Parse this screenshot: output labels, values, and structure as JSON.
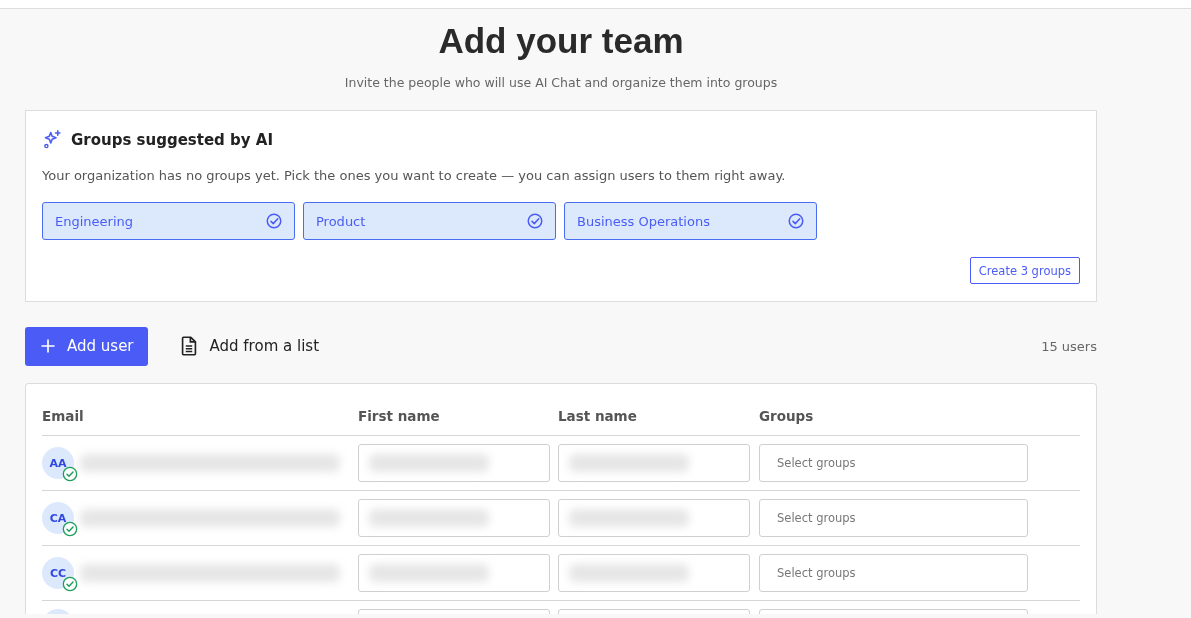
{
  "header": {
    "title": "Add your team",
    "subtitle": "Invite the people who will use AI Chat and organize them into groups"
  },
  "suggestions": {
    "title": "Groups suggested by AI",
    "description": "Your organization has no groups yet. Pick the ones you want to create — you can assign users to them right away.",
    "groups": [
      {
        "label": "Engineering",
        "selected": true
      },
      {
        "label": "Product",
        "selected": true
      },
      {
        "label": "Business Operations",
        "selected": true
      }
    ],
    "create_button": "Create 3 groups"
  },
  "toolbar": {
    "add_user": "Add user",
    "add_from_list": "Add from a list",
    "count": "15 users"
  },
  "table": {
    "columns": [
      "Email",
      "First name",
      "Last name",
      "Groups"
    ],
    "rows": [
      {
        "kind": "user",
        "initials": "AA",
        "verified": true,
        "redacted": true,
        "groups_placeholder": "Select groups"
      },
      {
        "kind": "user",
        "initials": "CA",
        "verified": true,
        "redacted": true,
        "groups_placeholder": "Select groups"
      },
      {
        "kind": "user",
        "initials": "CC",
        "verified": true,
        "redacted": true,
        "groups_placeholder": "Select groups"
      },
      {
        "kind": "cut"
      }
    ]
  }
}
